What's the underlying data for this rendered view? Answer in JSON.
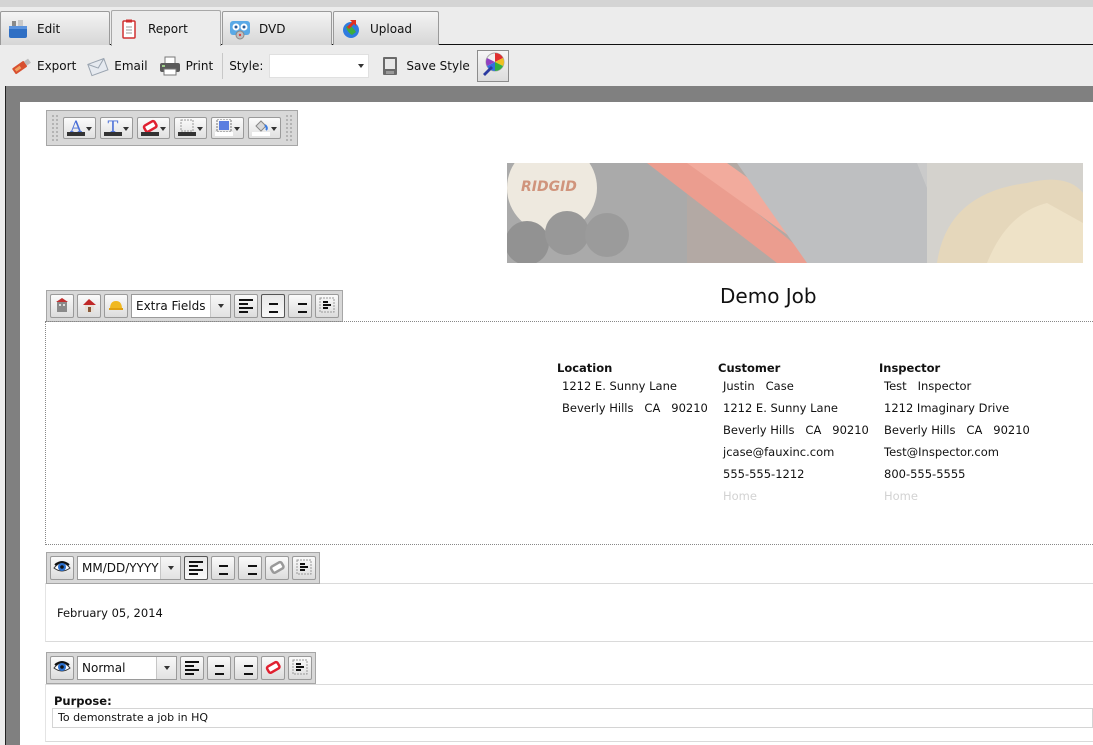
{
  "tabs": [
    {
      "label": "Edit",
      "icon": "toolbox-icon",
      "active": false
    },
    {
      "label": "Report",
      "icon": "report-icon",
      "active": true
    },
    {
      "label": "DVD",
      "icon": "dvd-icon",
      "active": false
    },
    {
      "label": "Upload",
      "icon": "globe-upload-icon",
      "active": false
    }
  ],
  "toolbar": {
    "export_label": "Export",
    "email_label": "Email",
    "print_label": "Print",
    "style_label": "Style:",
    "style_value": "",
    "save_style_label": "Save Style"
  },
  "report": {
    "title": "Demo Job",
    "header_toolbar": {
      "combo_value": "Extra Fields"
    },
    "location": {
      "heading": "Location",
      "lines": [
        "1212 E. Sunny Lane",
        "Beverly Hills   CA   90210"
      ]
    },
    "customer": {
      "heading": "Customer",
      "lines": [
        "Justin   Case",
        "1212 E. Sunny Lane",
        "Beverly Hills   CA   90210",
        "jcase@fauxinc.com",
        "555-555-1212"
      ],
      "placeholder": "Home"
    },
    "inspector": {
      "heading": "Inspector",
      "lines": [
        "Test   Inspector",
        "1212 Imaginary Drive",
        "Beverly Hills   CA   90210",
        "Test@Inspector.com",
        "800-555-5555"
      ],
      "placeholder": "Home"
    },
    "date_toolbar": {
      "combo_value": "MM/DD/YYYY"
    },
    "date_value": "February 05, 2014",
    "purpose_toolbar": {
      "combo_value": "Normal"
    },
    "purpose_label": "Purpose:",
    "purpose_value": "To demonstrate a job in HQ"
  },
  "colors": {
    "canvas_gray": "#808080",
    "chrome": "#ececec",
    "placeholder_text": "#d2d2d2",
    "accent_red": "#e02030",
    "accent_blue": "#4a6fd8"
  }
}
